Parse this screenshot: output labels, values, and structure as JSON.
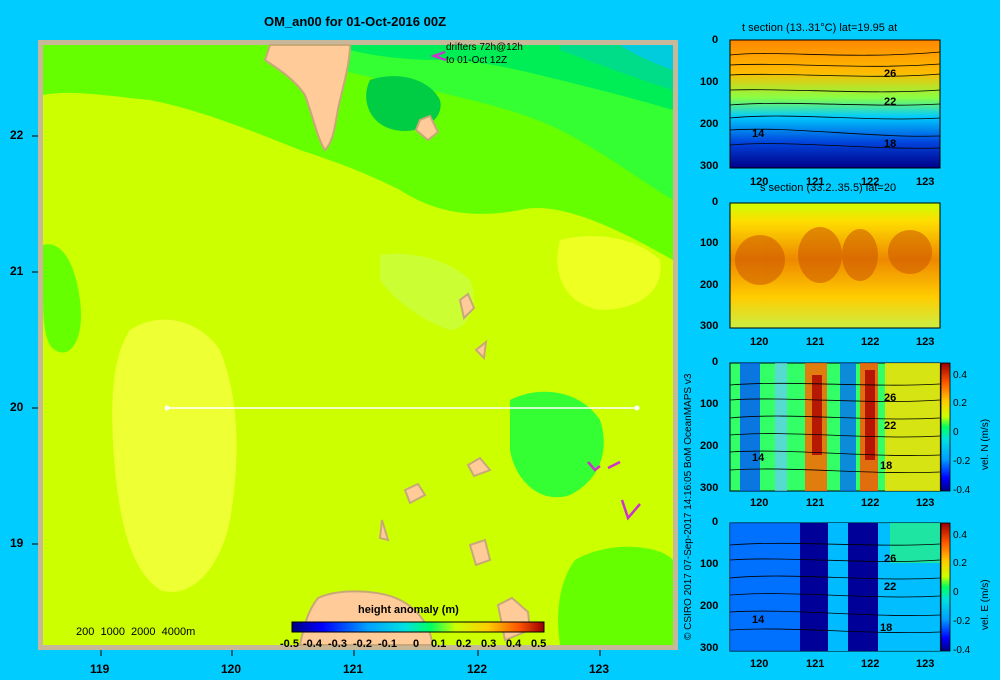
{
  "map": {
    "title": "OM_an00 for 01-Oct-2016 00Z",
    "drifters_line1": "drifters 72h@12h",
    "drifters_line2": "to 01-Oct 12Z",
    "depth_legend": "200  1000  2000  4000m",
    "colorbar_title": "height anomaly  (m)",
    "colorbar_ticks": [
      "-0.5",
      "-0.4",
      "-0.3",
      "-0.2",
      "-0.1",
      "0",
      "0.1",
      "0.2",
      "0.3",
      "0.4",
      "0.5"
    ],
    "x_ticks": [
      "119",
      "120",
      "121",
      "122",
      "123"
    ],
    "y_ticks": [
      "22",
      "21",
      "20",
      "19"
    ]
  },
  "panels": {
    "t_title": "t section (13..31°C) lat=19.95 at",
    "s_title": "s section (33.2..35.5) lat=20",
    "y_ticks": [
      "0",
      "100",
      "200",
      "300"
    ],
    "x_ticks": [
      "120",
      "121",
      "122",
      "123"
    ],
    "contour_labels_t": [
      "26",
      "22",
      "18",
      "14"
    ],
    "contour_labels_n": [
      "26",
      "22",
      "18",
      "14"
    ],
    "contour_labels_e": [
      "26",
      "22",
      "18",
      "14"
    ],
    "colorbar_ticks": [
      "0.4",
      "0.2",
      "0",
      "-0.2",
      "-0.4"
    ],
    "vel_n_label": "vel. N  (m/s)",
    "vel_e_label": "vel. E  (m/s)"
  },
  "credit": "© CSIRO 2017   07-Sep-2017 14:16:05 BoM OceanMAPS v3",
  "colors": {
    "background": "#00ccff",
    "land": "#ffcc99",
    "section_line": "#ffffff",
    "drifter": "#cc33cc"
  },
  "chart_data": [
    {
      "type": "heatmap",
      "title": "OM_an00 for 01-Oct-2016 00Z",
      "colorbar_label": "height anomaly  (m)",
      "x_range": [
        118.5,
        123.5
      ],
      "y_range": [
        18.3,
        22.7
      ],
      "x_ticks": [
        119,
        120,
        121,
        122,
        123
      ],
      "y_ticks": [
        19,
        20,
        21,
        22
      ],
      "value_range": [
        -0.5,
        0.5
      ],
      "section_line": {
        "lon": [
          119.5,
          123.2
        ],
        "lat": [
          20.0,
          20.0
        ]
      }
    },
    {
      "type": "heatmap",
      "title": "t section (13..31°C) lat=19.95 at",
      "x_ticks": [
        120,
        121,
        122,
        123
      ],
      "y_ticks": [
        0,
        100,
        200,
        300
      ],
      "contours": [
        26,
        22,
        18,
        14
      ]
    },
    {
      "type": "heatmap",
      "title": "s section (33.2..35.5) lat=20",
      "x_ticks": [
        120,
        121,
        122,
        123
      ],
      "y_ticks": [
        0,
        100,
        200,
        300
      ]
    },
    {
      "type": "heatmap",
      "colorbar_label": "vel. N  (m/s)",
      "x_ticks": [
        120,
        121,
        122,
        123
      ],
      "y_ticks": [
        0,
        100,
        200,
        300
      ],
      "value_range": [
        -0.4,
        0.4
      ],
      "contours": [
        26,
        22,
        18,
        14
      ]
    },
    {
      "type": "heatmap",
      "colorbar_label": "vel. E  (m/s)",
      "x_ticks": [
        120,
        121,
        122,
        123
      ],
      "y_ticks": [
        0,
        100,
        200,
        300
      ],
      "value_range": [
        -0.4,
        0.4
      ],
      "contours": [
        26,
        22,
        18,
        14
      ]
    }
  ]
}
